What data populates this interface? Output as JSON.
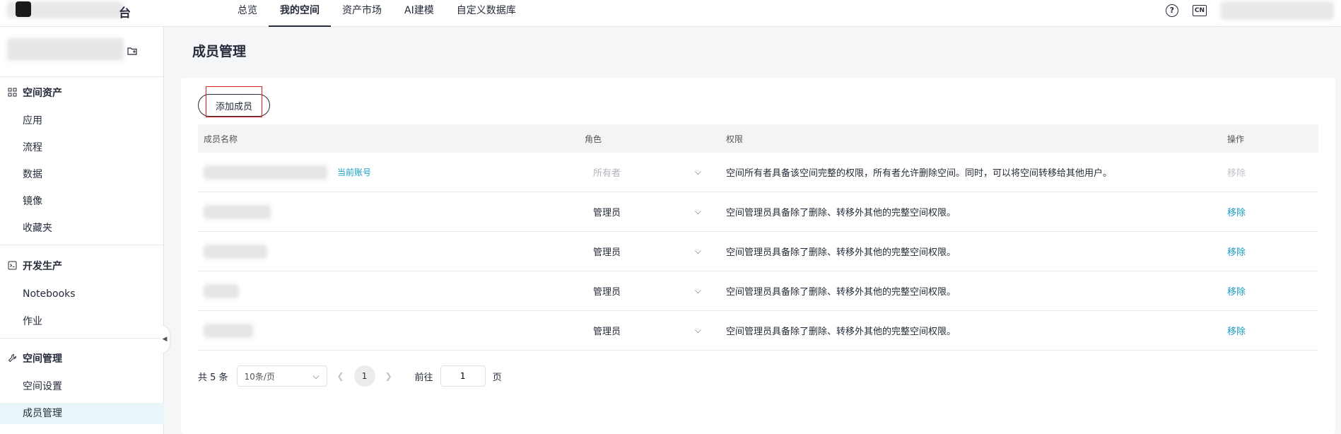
{
  "header": {
    "brand": "台",
    "nav": [
      "总览",
      "我的空间",
      "资产市场",
      "AI建模",
      "自定义数据库"
    ],
    "active_nav": "我的空间",
    "lang": "CN"
  },
  "sidebar": {
    "groups": [
      {
        "title": "空间资产",
        "items": [
          "应用",
          "流程",
          "数据",
          "镜像",
          "收藏夹"
        ]
      },
      {
        "title": "开发生产",
        "items": [
          "Notebooks",
          "作业"
        ]
      },
      {
        "title": "空间管理",
        "items": [
          "空间设置",
          "成员管理"
        ]
      }
    ],
    "active_item": "成员管理"
  },
  "main": {
    "title": "成员管理",
    "add_button": "添加成员",
    "columns": [
      "成员名称",
      "角色",
      "权限",
      "操作"
    ],
    "current_account_tag": "当前账号",
    "rows": [
      {
        "role": "所有者",
        "permission": "空间所有者具备该空间完整的权限，所有者允许删除空间。同时，可以将空间转移给其他用户。",
        "action": "移除"
      },
      {
        "role": "管理员",
        "permission": "空间管理员具备除了删除、转移外其他的完整空间权限。",
        "action": "移除"
      },
      {
        "role": "管理员",
        "permission": "空间管理员具备除了删除、转移外其他的完整空间权限。",
        "action": "移除"
      },
      {
        "role": "管理员",
        "permission": "空间管理员具备除了删除、转移外其他的完整空间权限。",
        "action": "移除"
      },
      {
        "role": "管理员",
        "permission": "空间管理员具备除了删除、转移外其他的完整空间权限。",
        "action": "移除"
      }
    ],
    "pagination": {
      "total": "共 5 条",
      "page_size": "10条/页",
      "current_page": "1",
      "goto_label": "前往",
      "goto_value": "1",
      "page_suffix": "页"
    }
  }
}
